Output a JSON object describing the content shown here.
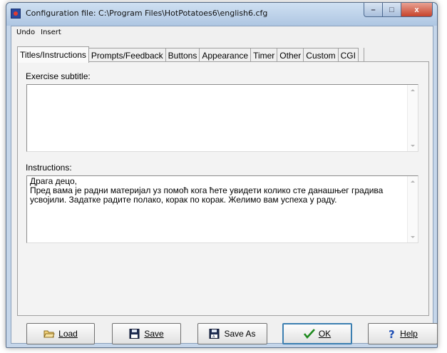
{
  "window": {
    "title": "Configuration file: C:\\Program Files\\HotPotatoes6\\english6.cfg",
    "caption": {
      "minimize": "–",
      "maximize": "□",
      "close": "x"
    }
  },
  "menu": {
    "items": [
      "Undo",
      "Insert"
    ]
  },
  "tabs": [
    "Titles/Instructions",
    "Prompts/Feedback",
    "Buttons",
    "Appearance",
    "Timer",
    "Other",
    "Custom",
    "CGI"
  ],
  "active_tab": "Titles/Instructions",
  "fields": {
    "subtitle_label": "Exercise subtitle:",
    "subtitle_value": "",
    "instructions_label": "Instructions:",
    "instructions_value": "Драга децо,\nПред вама је радни материјал уз помоћ кога ћете увидети колико сте данашњег градива усвојили. Задатке радите полако, корак по корак. Желимо вам успеха у раду."
  },
  "buttons": {
    "load": "Load",
    "save": "Save",
    "save_as": "Save As",
    "ok": "OK",
    "help": "Help"
  },
  "icons": {
    "load": "folder-open-icon",
    "save": "floppy-disk-icon",
    "save_as": "floppy-disk-edit-icon",
    "ok": "checkmark-icon",
    "help": "question-mark-icon"
  },
  "colors": {
    "title_bar": "#b9cde6",
    "close_button": "#c7432b",
    "ok_check": "#1e8a1e",
    "help_mark": "#1f4fb5"
  }
}
